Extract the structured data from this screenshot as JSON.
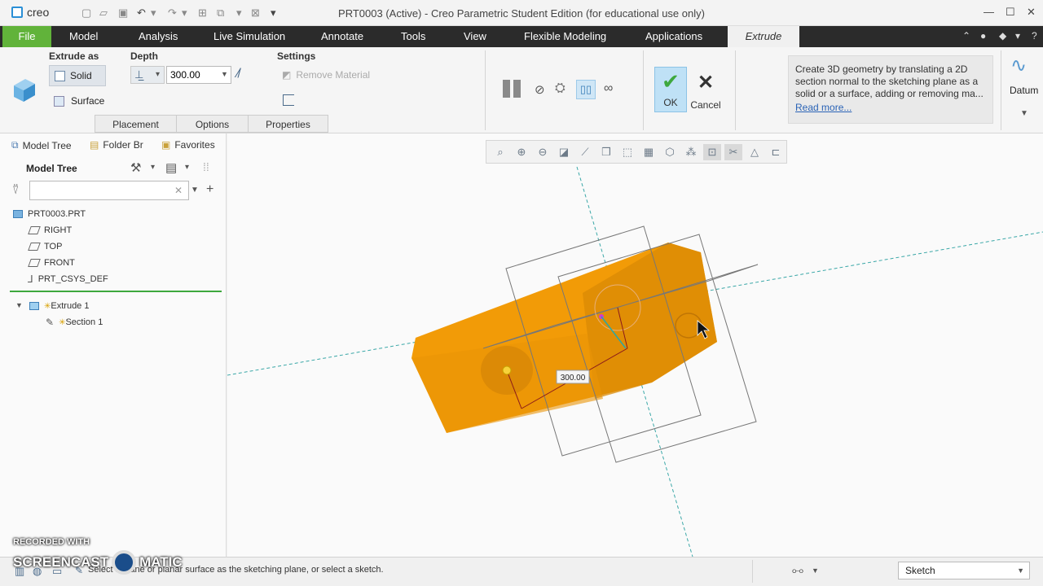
{
  "app": {
    "logo_text": "creo",
    "window_title": "PRT0003 (Active) - Creo Parametric Student Edition (for educational use only)"
  },
  "menu": {
    "file": "File",
    "tabs": [
      "Model",
      "Analysis",
      "Live Simulation",
      "Annotate",
      "Tools",
      "View",
      "Flexible Modeling",
      "Applications"
    ],
    "active_tab": "Extrude"
  },
  "ribbon": {
    "extrude_as_label": "Extrude as",
    "solid_label": "Solid",
    "surface_label": "Surface",
    "depth_label": "Depth",
    "depth_value": "300.00",
    "settings_label": "Settings",
    "remove_material_label": "Remove Material",
    "ok_label": "OK",
    "cancel_label": "Cancel",
    "datum_label": "Datum",
    "subtabs": [
      "Placement",
      "Options",
      "Properties"
    ],
    "tooltip_text": "Create 3D geometry by translating a 2D section normal to the sketching plane as a solid or a surface, adding or removing ma...",
    "tooltip_link": "Read more..."
  },
  "left_panel": {
    "tabs": [
      "Model Tree",
      "Folder Br",
      "Favorites"
    ],
    "header": "Model Tree",
    "filter_placeholder": "",
    "tree": [
      "PRT0003.PRT",
      "RIGHT",
      "TOP",
      "FRONT",
      "PRT_CSYS_DEF",
      "Extrude 1",
      "Section 1"
    ]
  },
  "viewport": {
    "dimension_label": "300.00"
  },
  "status": {
    "message": "Select a plane or planar surface as the sketching plane, or select a sketch.",
    "mode": "Sketch"
  },
  "watermark": {
    "line1": "RECORDED WITH",
    "line2": "SCREENCAST",
    "line3": "MATIC"
  },
  "colors": {
    "accent": "#61b33a",
    "menubar": "#2b2b2b",
    "part": "#f29b07",
    "ok_bg": "#bfe1f6"
  }
}
